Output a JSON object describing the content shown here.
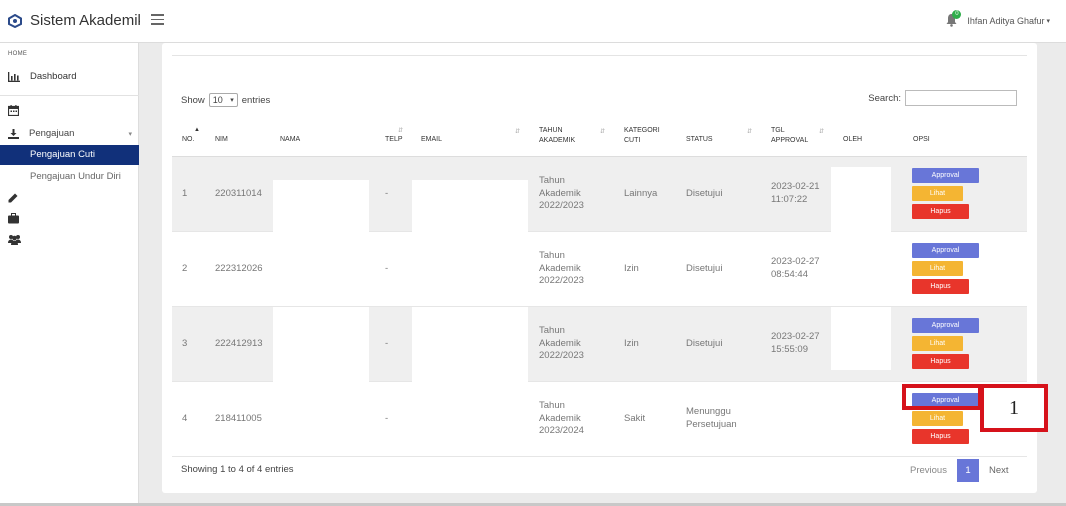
{
  "header": {
    "app_title": "Sistem Akademik",
    "user_name": "Ihfan Aditya Ghafur",
    "notification_count": "0"
  },
  "sidebar": {
    "heading": "HOME",
    "dashboard": "Dashboard",
    "pengajuan": "Pengajuan",
    "active_item": "Pengajuan Cuti",
    "sub_item": "Pengajuan Undur Diri"
  },
  "table_controls": {
    "show_label": "Show",
    "show_value": "10",
    "entries_label": "entries",
    "search_label": "Search:",
    "search_value": ""
  },
  "columns": {
    "no": "NO.",
    "nim": "NIM",
    "nama": "NAMA",
    "telp": "TELP",
    "email": "EMAIL",
    "tahun_1": "TAHUN",
    "tahun_2": "AKADEMIK",
    "kategori_1": "KATEGORI",
    "kategori_2": "CUTI",
    "status": "STATUS",
    "tgl_1": "TGL",
    "tgl_2": "APPROVAL",
    "oleh": "OLEH",
    "opsi": "OPSI"
  },
  "rows": [
    {
      "no": "1",
      "nim": "220311014",
      "telp": "-",
      "tahun_l1": "Tahun",
      "tahun_l2": "Akademik",
      "tahun_l3": "2022/2023",
      "kategori": "Lainnya",
      "status_l1": "Disetujui",
      "status_l2": "",
      "tgl_l1": "2023-02-21",
      "tgl_l2": "11:07:22"
    },
    {
      "no": "2",
      "nim": "222312026",
      "telp": "-",
      "tahun_l1": "Tahun",
      "tahun_l2": "Akademik",
      "tahun_l3": "2022/2023",
      "kategori": "Izin",
      "status_l1": "Disetujui",
      "status_l2": "",
      "tgl_l1": "2023-02-27",
      "tgl_l2": "08:54:44"
    },
    {
      "no": "3",
      "nim": "222412913",
      "telp": "-",
      "tahun_l1": "Tahun",
      "tahun_l2": "Akademik",
      "tahun_l3": "2022/2023",
      "kategori": "Izin",
      "status_l1": "Disetujui",
      "status_l2": "",
      "tgl_l1": "2023-02-27",
      "tgl_l2": "15:55:09"
    },
    {
      "no": "4",
      "nim": "218411005",
      "telp": "-",
      "tahun_l1": "Tahun",
      "tahun_l2": "Akademik",
      "tahun_l3": "2023/2024",
      "kategori": "Sakit",
      "status_l1": "Menunggu",
      "status_l2": "Persetujuan",
      "tgl_l1": "",
      "tgl_l2": ""
    }
  ],
  "actions": {
    "approval": "Approval",
    "lihat": "Lihat",
    "hapus": "Hapus"
  },
  "footer": {
    "showing": "Showing 1 to 4 of 4 entries",
    "previous": "Previous",
    "page": "1",
    "next": "Next"
  },
  "annotation": {
    "label": "1"
  },
  "colors": {
    "active_nav": "#11307a",
    "approval": "#6876d8",
    "lihat": "#f4b533",
    "hapus": "#e8352b",
    "annotation": "#d6121b"
  }
}
